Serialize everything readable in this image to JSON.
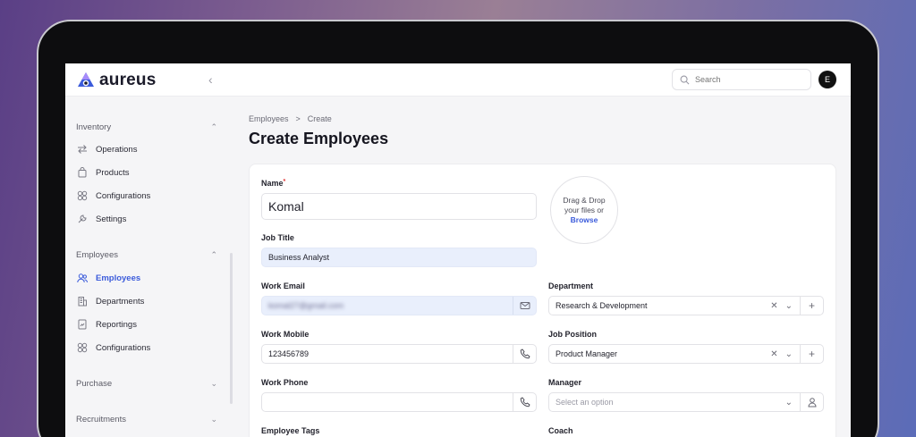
{
  "app": {
    "name": "aureus"
  },
  "search": {
    "placeholder": "Search"
  },
  "user": {
    "initial": "E"
  },
  "sidebar": {
    "groups": [
      {
        "label": "Inventory",
        "items": [
          {
            "label": "Operations",
            "icon": "swap-arrows-icon"
          },
          {
            "label": "Products",
            "icon": "shopping-bag-icon"
          },
          {
            "label": "Configurations",
            "icon": "grid-icon"
          },
          {
            "label": "Settings",
            "icon": "wrench-icon"
          }
        ]
      },
      {
        "label": "Employees",
        "items": [
          {
            "label": "Employees",
            "icon": "users-icon",
            "active": true
          },
          {
            "label": "Departments",
            "icon": "building-icon"
          },
          {
            "label": "Reportings",
            "icon": "report-icon"
          },
          {
            "label": "Configurations",
            "icon": "grid-icon"
          }
        ]
      },
      {
        "label": "Purchase",
        "items": []
      },
      {
        "label": "Recruitments",
        "items": []
      }
    ]
  },
  "breadcrumb": {
    "parent": "Employees",
    "separator": ">",
    "current": "Create"
  },
  "page": {
    "title": "Create Employees"
  },
  "form": {
    "name": {
      "label": "Name",
      "required_mark": "*",
      "value": "Komal"
    },
    "job_title": {
      "label": "Job Title",
      "value": "Business Analyst"
    },
    "work_email": {
      "label": "Work Email",
      "value": "komal27@gmail.com"
    },
    "department": {
      "label": "Department",
      "value": "Research & Development"
    },
    "work_mobile": {
      "label": "Work Mobile",
      "value": "123456789"
    },
    "job_position": {
      "label": "Job Position",
      "value": "Product Manager"
    },
    "work_phone": {
      "label": "Work Phone",
      "value": ""
    },
    "manager": {
      "label": "Manager",
      "placeholder": "Select an option"
    },
    "employee_tags": {
      "label": "Employee Tags"
    },
    "coach": {
      "label": "Coach"
    },
    "dropzone": {
      "line1": "Drag & Drop",
      "line2": "your files or",
      "browse": "Browse"
    }
  },
  "colors": {
    "accent": "#3b5bdb",
    "tinted_field": "#e9effc"
  }
}
